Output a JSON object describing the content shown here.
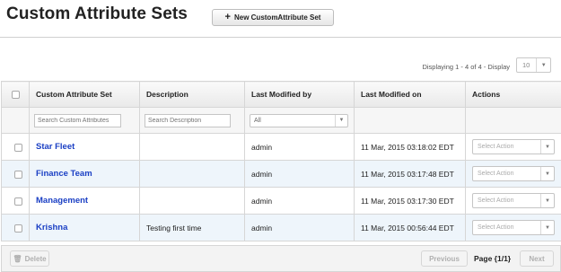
{
  "header": {
    "title": "Custom Attribute Sets",
    "new_button_icon": "+",
    "new_button_label": "New CustomAttribute Set"
  },
  "pagination_top": {
    "display_text": "Displaying 1 - 4 of 4 - Display",
    "page_size": "10"
  },
  "table": {
    "columns": [
      "Custom Attribute Set",
      "Description",
      "Last Modified by",
      "Last Modified on",
      "Actions"
    ],
    "filters": {
      "name_placeholder": "Search Custom Attributes",
      "description_placeholder": "Search Description",
      "modified_by_value": "All"
    },
    "rows": [
      {
        "name": "Star Fleet",
        "description": "",
        "modified_by": "admin",
        "modified_on": "11 Mar, 2015 03:18:02 EDT",
        "action": "Select Action"
      },
      {
        "name": "Finance Team",
        "description": "",
        "modified_by": "admin",
        "modified_on": "11 Mar, 2015 03:17:48 EDT",
        "action": "Select Action"
      },
      {
        "name": "Management",
        "description": "",
        "modified_by": "admin",
        "modified_on": "11 Mar, 2015 03:17:30 EDT",
        "action": "Select Action"
      },
      {
        "name": "Krishna",
        "description": "Testing first time",
        "modified_by": "admin",
        "modified_on": "11 Mar, 2015 00:56:44 EDT",
        "action": "Select Action"
      }
    ]
  },
  "footer": {
    "delete_label": "Delete",
    "previous_label": "Previous",
    "page_indicator": "Page {1/1}",
    "next_label": "Next"
  },
  "colors": {
    "link": "#1a3fc4",
    "row_alt": "#eef5fb"
  }
}
